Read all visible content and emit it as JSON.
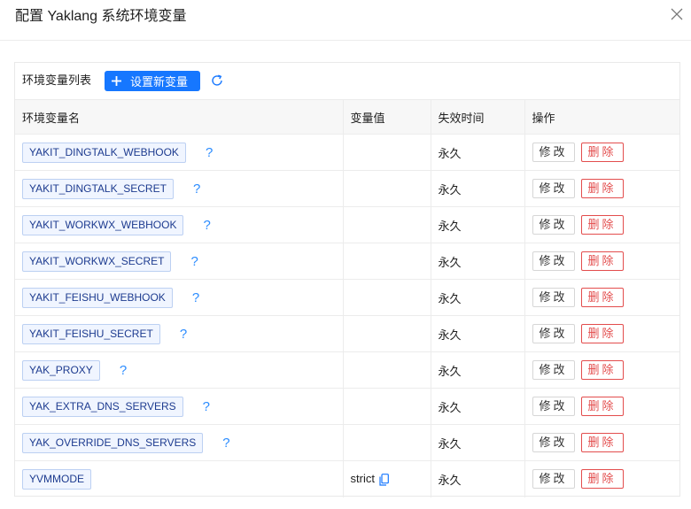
{
  "modal": {
    "title": "配置 Yaklang 系统环境变量"
  },
  "toolbar": {
    "label": "环境变量列表",
    "add_label": "设置新变量"
  },
  "table": {
    "columns": [
      "环境变量名",
      "变量值",
      "失效时间",
      "操作"
    ],
    "rows": [
      {
        "name": "YAKIT_DINGTALK_WEBHOOK",
        "value": "",
        "expire": "永久",
        "help": "?"
      },
      {
        "name": "YAKIT_DINGTALK_SECRET",
        "value": "",
        "expire": "永久",
        "help": "?"
      },
      {
        "name": "YAKIT_WORKWX_WEBHOOK",
        "value": "",
        "expire": "永久",
        "help": "?"
      },
      {
        "name": "YAKIT_WORKWX_SECRET",
        "value": "",
        "expire": "永久",
        "help": "?"
      },
      {
        "name": "YAKIT_FEISHU_WEBHOOK",
        "value": "",
        "expire": "永久",
        "help": "?"
      },
      {
        "name": "YAKIT_FEISHU_SECRET",
        "value": "",
        "expire": "永久",
        "help": "?"
      },
      {
        "name": "YAK_PROXY",
        "value": "",
        "expire": "永久",
        "help": "?"
      },
      {
        "name": "YAK_EXTRA_DNS_SERVERS",
        "value": "",
        "expire": "永久",
        "help": "?"
      },
      {
        "name": "YAK_OVERRIDE_DNS_SERVERS",
        "value": "",
        "expire": "永久",
        "help": "?"
      },
      {
        "name": "YVMMODE",
        "value": "strict",
        "expire": "永久",
        "help": ""
      }
    ],
    "edit_label": "修改",
    "delete_label": "删除"
  },
  "icons": {
    "close": "close-icon",
    "add": "plus-icon",
    "refresh": "refresh-icon",
    "help": "question-icon",
    "copy": "copy-icon"
  },
  "colors": {
    "primary": "#1677ff",
    "danger": "#e34d4d",
    "tag_bg": "#f0f5ff",
    "tag_border": "#bcd0f2"
  }
}
